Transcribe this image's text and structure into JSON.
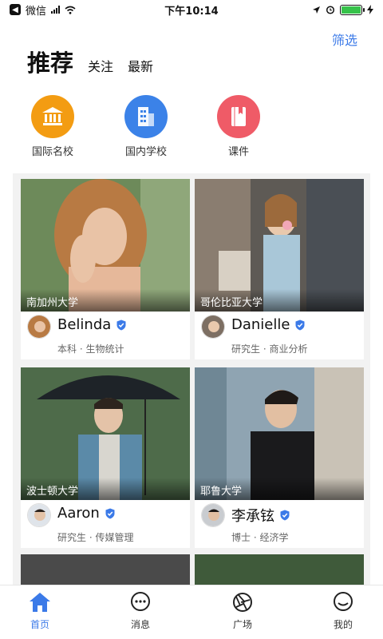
{
  "status_bar": {
    "carrier": "微信",
    "time": "下午10:14",
    "battery_color": "#36c24a"
  },
  "header": {
    "filter_label": "筛选",
    "tabs": [
      "推荐",
      "关注",
      "最新"
    ]
  },
  "categories": [
    {
      "label": "国际名校",
      "icon": "university-icon",
      "color": "#f39c12"
    },
    {
      "label": "国内学校",
      "icon": "building-icon",
      "color": "#3b82e8"
    },
    {
      "label": "课件",
      "icon": "book-icon",
      "color": "#ef5b67"
    }
  ],
  "cards": [
    {
      "school": "南加州大学",
      "name": "Belinda",
      "meta": "本科 · 生物统计",
      "verified": true
    },
    {
      "school": "哥伦比亚大学",
      "name": "Danielle",
      "meta": "研究生 · 商业分析",
      "verified": true
    },
    {
      "school": "波士顿大学",
      "name": "Aaron",
      "meta": "研究生 · 传媒管理",
      "verified": true
    },
    {
      "school": "耶鲁大学",
      "name": "李承铉",
      "meta": "博士 · 经济学",
      "verified": true
    }
  ],
  "tabbar": [
    {
      "label": "首页",
      "icon": "home-icon",
      "active": true
    },
    {
      "label": "消息",
      "icon": "message-icon",
      "active": false
    },
    {
      "label": "广场",
      "icon": "aperture-icon",
      "active": false
    },
    {
      "label": "我的",
      "icon": "profile-icon",
      "active": false
    }
  ],
  "colors": {
    "accent": "#3b7ae8",
    "verify_badge": "#3b7ae8"
  }
}
